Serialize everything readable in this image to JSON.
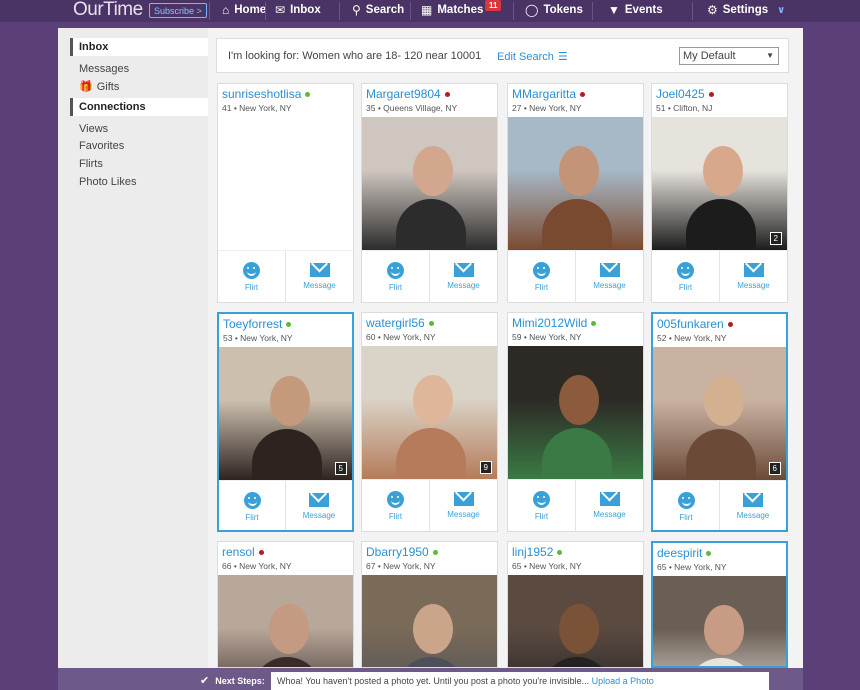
{
  "app": {
    "logo": "OurTime",
    "subscribe_label": "Subscribe >"
  },
  "nav": {
    "home": "Home",
    "inbox": "Inbox",
    "search": "Search",
    "matches": "Matches",
    "matches_badge": "11",
    "tokens": "Tokens",
    "events": "Events",
    "settings": "Settings"
  },
  "sidebar": {
    "inbox_head": "Inbox",
    "messages": "Messages",
    "gifts": "Gifts",
    "connections_head": "Connections",
    "views": "Views",
    "favorites": "Favorites",
    "flirts": "Flirts",
    "photo_likes": "Photo Likes"
  },
  "search": {
    "looking_for": "I'm looking for: Women who are 18- 120 near 10001",
    "edit_search": "Edit Search",
    "sort_selected": "My Default"
  },
  "colors": {
    "online": "#5fb83a",
    "offline": "#b01c22",
    "accent": "#3aa0d8"
  },
  "actions": {
    "flirt": "Flirt",
    "message": "Message"
  },
  "profiles": [
    {
      "name": "sunriseshotlisa",
      "meta": "41 • New York, NY",
      "status": "online",
      "photos": "",
      "photo": false,
      "highlight": false
    },
    {
      "name": "Margaret9804",
      "meta": "35 • Queens Village, NY",
      "status": "offline",
      "photos": "",
      "photo": true,
      "highlight": false
    },
    {
      "name": "MMargaritta",
      "meta": "27 • New York, NY",
      "status": "offline",
      "photos": "",
      "photo": true,
      "highlight": false
    },
    {
      "name": "Joel0425",
      "meta": "51 • Clifton, NJ",
      "status": "offline",
      "photos": "2",
      "photo": true,
      "highlight": false
    },
    {
      "name": "Toeyforrest",
      "meta": "53 • New York, NY",
      "status": "online",
      "photos": "5",
      "photo": true,
      "highlight": true
    },
    {
      "name": "watergirl56",
      "meta": "60 • New York, NY",
      "status": "online",
      "photos": "9",
      "photo": true,
      "highlight": false
    },
    {
      "name": "Mimi2012Wild",
      "meta": "59 • New York, NY",
      "status": "online",
      "photos": "",
      "photo": true,
      "highlight": false
    },
    {
      "name": "005funkaren",
      "meta": "52 • New York, NY",
      "status": "offline",
      "photos": "6",
      "photo": true,
      "highlight": true
    },
    {
      "name": "rensol",
      "meta": "66 • New York, NY",
      "status": "offline",
      "photos": "",
      "photo": true,
      "highlight": false
    },
    {
      "name": "Dbarry1950",
      "meta": "67 • New York, NY",
      "status": "online",
      "photos": "",
      "photo": true,
      "highlight": false
    },
    {
      "name": "linj1952",
      "meta": "65 • New York, NY",
      "status": "online",
      "photos": "",
      "photo": true,
      "highlight": false
    },
    {
      "name": "deespirit",
      "meta": "65 • New York, NY",
      "status": "online",
      "photos": "",
      "photo": true,
      "highlight": true
    }
  ],
  "next_steps": {
    "label": "Next Steps:",
    "message": "Whoa! You haven't posted a photo yet. Until you post a photo you're invisible...",
    "link": "Upload a Photo"
  }
}
